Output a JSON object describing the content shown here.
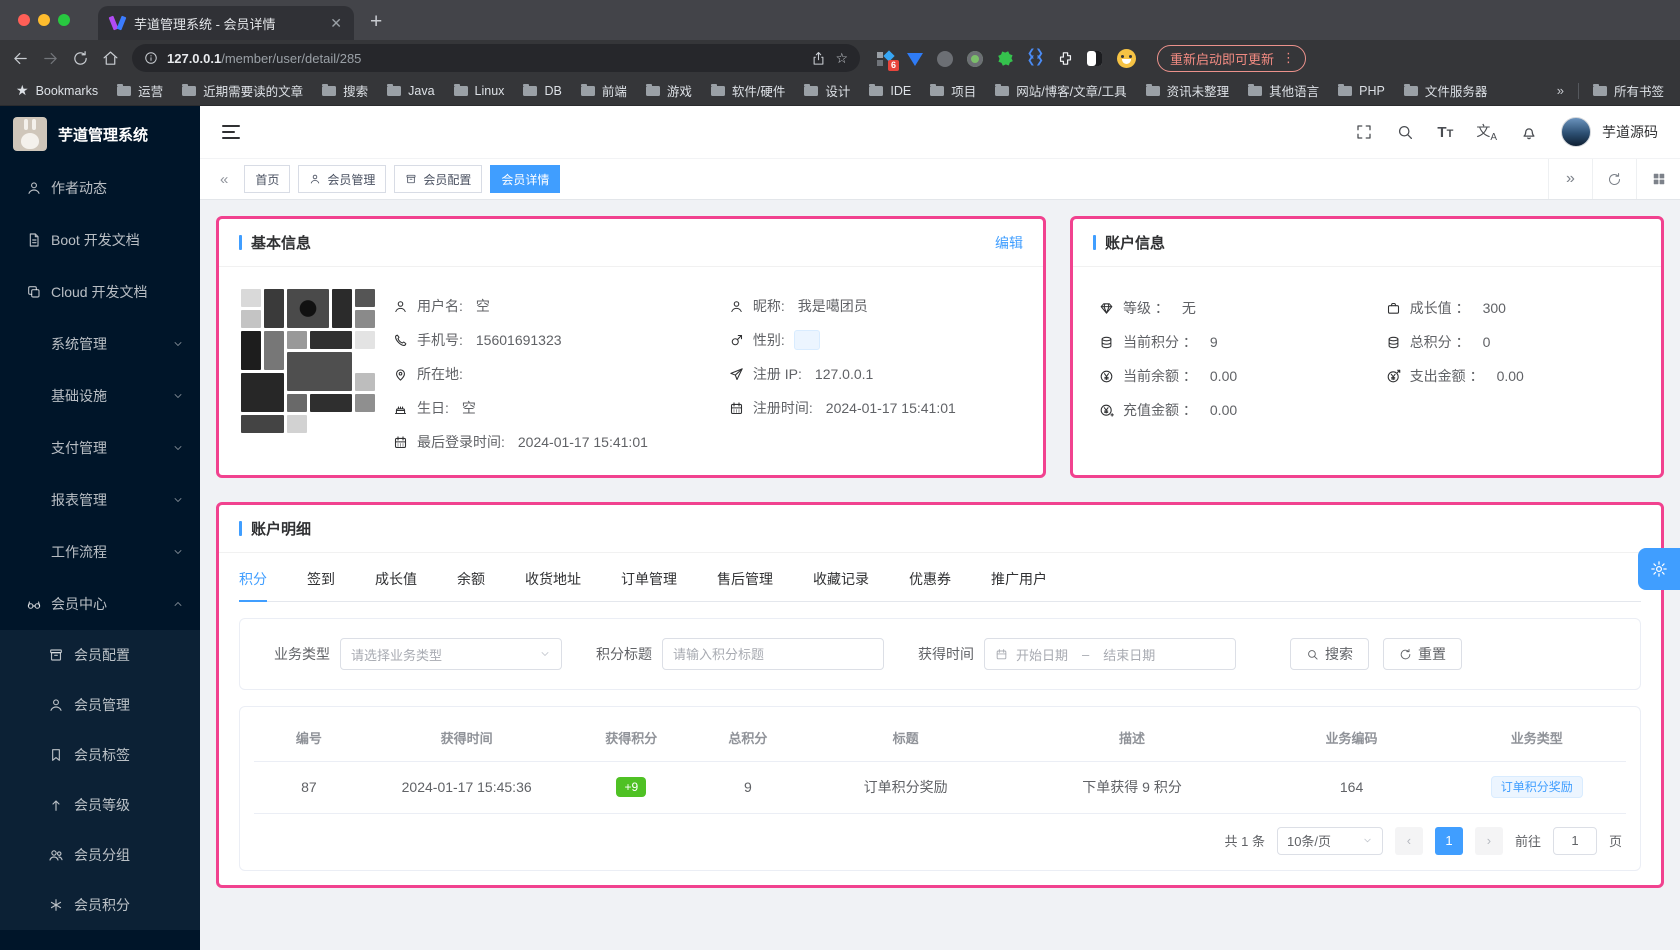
{
  "colors": {
    "accent": "#409eff",
    "highlight_border": "#f1428f",
    "badge_green": "#4fc124",
    "sidebar_bg": "#001529"
  },
  "browser": {
    "tab_title": "芋道管理系统 - 会员详情",
    "url_domain": "127.0.0.1",
    "url_path": "/member/user/detail/285",
    "extension_badge": "6",
    "update_button": "重新启动即可更新",
    "bookmarks_label": "Bookmarks",
    "bookmarks": [
      "运营",
      "近期需要读的文章",
      "搜索",
      "Java",
      "Linux",
      "DB",
      "前端",
      "游戏",
      "软件/硬件",
      "设计",
      "IDE",
      "项目",
      "网站/博客/文章/工具",
      "资讯未整理",
      "其他语言",
      "PHP",
      "文件服务器"
    ],
    "all_bookmarks_label": "所有书签"
  },
  "sidebar": {
    "logo_title": "芋道管理系统",
    "items": [
      {
        "label": "作者动态"
      },
      {
        "label": "Boot 开发文档"
      },
      {
        "label": "Cloud 开发文档"
      },
      {
        "label": "系统管理"
      },
      {
        "label": "基础设施"
      },
      {
        "label": "支付管理"
      },
      {
        "label": "报表管理"
      },
      {
        "label": "工作流程"
      },
      {
        "label": "会员中心"
      }
    ],
    "member_children": [
      {
        "label": "会员配置"
      },
      {
        "label": "会员管理"
      },
      {
        "label": "会员标签"
      },
      {
        "label": "会员等级"
      },
      {
        "label": "会员分组"
      },
      {
        "label": "会员积分"
      }
    ]
  },
  "header": {
    "username": "芋道源码"
  },
  "tags": {
    "items": [
      "首页",
      "会员管理",
      "会员配置",
      "会员详情"
    ],
    "active": "会员详情"
  },
  "basic_info": {
    "title": "基本信息",
    "edit_label": "编辑",
    "fields": {
      "username_label": "用户名:",
      "username": "空",
      "nickname_label": "昵称:",
      "nickname": "我是噶团员",
      "mobile_label": "手机号:",
      "mobile": "15601691323",
      "gender_label": "性别:",
      "area_label": "所在地:",
      "area": "",
      "register_ip_label": "注册 IP:",
      "register_ip": "127.0.0.1",
      "birthday_label": "生日:",
      "birthday": "空",
      "register_time_label": "注册时间:",
      "register_time": "2024-01-17 15:41:01",
      "last_login_label": "最后登录时间:",
      "last_login": "2024-01-17 15:41:01"
    }
  },
  "account_info": {
    "title": "账户信息",
    "fields": {
      "level_label": "等级 ：",
      "level": "无",
      "growth_label": "成长值 ：",
      "growth": "300",
      "point_label": "当前积分 ：",
      "point": "9",
      "total_point_label": "总积分 ：",
      "total_point": "0",
      "balance_label": "当前余额 ：",
      "balance": "0.00",
      "expense_label": "支出金额 ：",
      "expense": "0.00",
      "recharge_label": "充值金额 ：",
      "recharge": "0.00"
    }
  },
  "account_detail": {
    "title": "账户明细",
    "tabs": [
      "积分",
      "签到",
      "成长值",
      "余额",
      "收货地址",
      "订单管理",
      "售后管理",
      "收藏记录",
      "优惠券",
      "推广用户"
    ],
    "active_tab": "积分",
    "filters": {
      "biz_type_label": "业务类型",
      "biz_type_placeholder": "请选择业务类型",
      "title_label": "积分标题",
      "title_placeholder": "请输入积分标题",
      "time_label": "获得时间",
      "start_placeholder": "开始日期",
      "range_separator": "–",
      "end_placeholder": "结束日期",
      "search_label": "搜索",
      "reset_label": "重置"
    },
    "table": {
      "headers": [
        "编号",
        "获得时间",
        "获得积分",
        "总积分",
        "标题",
        "描述",
        "业务编码",
        "业务类型"
      ],
      "rows": [
        {
          "id": "87",
          "time": "2024-01-17 15:45:36",
          "point": "+9",
          "total": "9",
          "title": "订单积分奖励",
          "desc": "下单获得 9 积分",
          "biz_id": "164",
          "biz_type": "订单积分奖励"
        }
      ]
    },
    "pagination": {
      "total": "共 1 条",
      "page_size": "10条/页",
      "page": "1",
      "goto_label": "前往",
      "goto_value": "1",
      "page_label": "页"
    }
  }
}
